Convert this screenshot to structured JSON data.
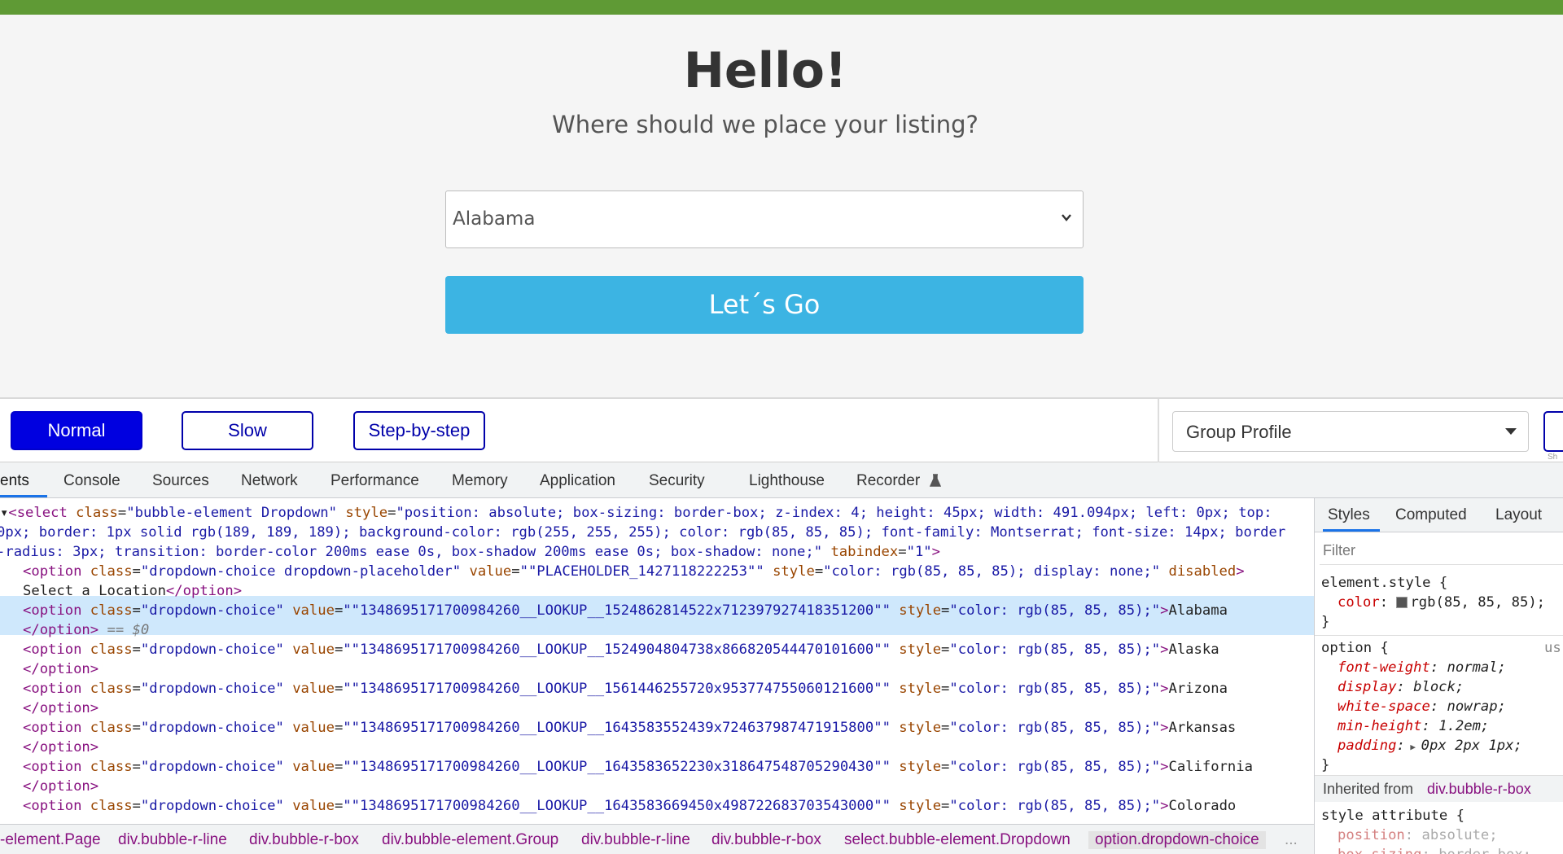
{
  "hero": {
    "title": "Hello!",
    "subtitle": "Where should we place your listing?",
    "dropdown_value": "Alabama",
    "go_label": "Let´s Go"
  },
  "toolbar": {
    "speeds": [
      "Normal",
      "Slow",
      "Step-by-step"
    ],
    "profile": "Group Profile",
    "edge_hint": "Sh"
  },
  "devtools": {
    "tabs": [
      "ents",
      "Console",
      "Sources",
      "Network",
      "Performance",
      "Memory",
      "Application",
      "Security",
      "Lighthouse",
      "Recorder"
    ],
    "code_lines": [
      "<select class=\"bubble-element Dropdown\" style=\"position: absolute; box-sizing: border-box; z-index: 4; height: 45px; width: 491.094px; left: 0px; top:",
      "0px; border: 1px solid rgb(189, 189, 189); background-color: rgb(255, 255, 255); color: rgb(85, 85, 85); font-family: Montserrat; font-size: 14px; border",
      "-radius: 3px; transition: border-color 200ms ease 0s, box-shadow 200ms ease 0s; box-shadow: none;\" tabindex=\"1\">"
    ],
    "placeholder_option": {
      "value": "\"PLACEHOLDER_1427118222253\"",
      "style": "color: rgb(85, 85, 85); display: none;",
      "text": "Select a Location"
    },
    "options": [
      {
        "value": "\"1348695171700984260__LOOKUP__1524862814522x712397927418351200\"",
        "text": "Alabama"
      },
      {
        "value": "\"1348695171700984260__LOOKUP__1524904804738x866820544470101600\"",
        "text": "Alaska"
      },
      {
        "value": "\"1348695171700984260__LOOKUP__1561446255720x953774755060121600\"",
        "text": "Arizona"
      },
      {
        "value": "\"1348695171700984260__LOOKUP__1643583552439x724637987471915800\"",
        "text": "Arkansas"
      },
      {
        "value": "\"1348695171700984260__LOOKUP__1643583652230x318647548705290430\"",
        "text": "California"
      },
      {
        "value": "\"1348695171700984260__LOOKUP__1643583669450x498722683703543000\"",
        "text": "Colorado"
      }
    ],
    "option_style": "color: rgb(85, 85, 85);",
    "selected_marker": "== $0",
    "breadcrumbs": [
      "-element.Page",
      "div.bubble-r-line",
      "div.bubble-r-box",
      "div.bubble-element.Group",
      "div.bubble-r-line",
      "div.bubble-r-box",
      "select.bubble-element.Dropdown",
      "option.dropdown-choice"
    ],
    "breadcrumb_more": "...",
    "styles_tabs": [
      "Styles",
      "Computed",
      "Layout"
    ],
    "filter": "Filter",
    "styles": {
      "element_style_selector": "element.style {",
      "element_color_prop": "color",
      "element_color_value": "rgb(85, 85, 85);",
      "option_selector": "option {",
      "option_ua": "us",
      "option_rules": [
        {
          "prop": "font-weight",
          "value": "normal;"
        },
        {
          "prop": "display",
          "value": "block;"
        },
        {
          "prop": "white-space",
          "value": "nowrap;"
        },
        {
          "prop": "min-height",
          "value": "1.2em;"
        },
        {
          "prop": "padding",
          "value": "0px 2px 1px;"
        }
      ],
      "inherited_label": "Inherited from",
      "inherited_from": "div.bubble-r-box",
      "style_attr_selector": "style attribute {",
      "style_attr_first_prop": "position",
      "style_attr_first_value": "absolute;",
      "style_attr_second_prop": "box-sizing",
      "style_attr_second_value": "border-box;"
    }
  }
}
